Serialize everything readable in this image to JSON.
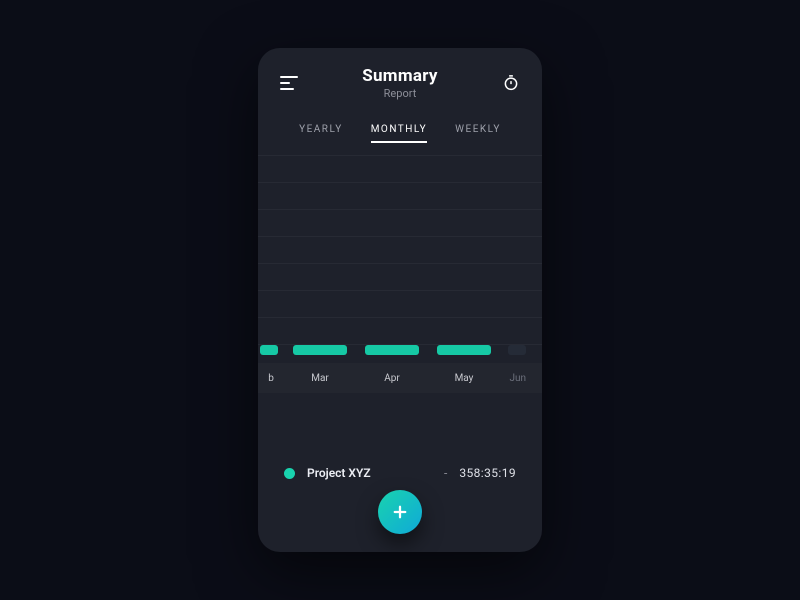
{
  "header": {
    "title": "Summary",
    "subtitle": "Report"
  },
  "tabs": [
    {
      "label": "YEARLY",
      "active": false
    },
    {
      "label": "MONTHLY",
      "active": true
    },
    {
      "label": "WEEKLY",
      "active": false
    }
  ],
  "chart_data": {
    "type": "bar",
    "categories": [
      "Feb",
      "Mar",
      "Apr",
      "May",
      "Jun"
    ],
    "values": [
      10,
      10,
      10,
      10,
      10
    ],
    "title": "",
    "xlabel": "",
    "ylabel": "",
    "ylim": [
      0,
      200
    ],
    "visible_partial": {
      "left": "b",
      "right": "Jun"
    }
  },
  "project": {
    "name": "Project XYZ",
    "separator": "-",
    "time": "358:35:19",
    "dot_color": "#19d3ae"
  },
  "icons": {
    "menu": "menu-icon",
    "timer": "timer-icon",
    "add": "plus-icon"
  },
  "colors": {
    "bar": "#16c9a5",
    "accent_start": "#19d3ae",
    "accent_end": "#0fa9d8",
    "panel": "#1e212b",
    "background": "#0b0d17"
  }
}
